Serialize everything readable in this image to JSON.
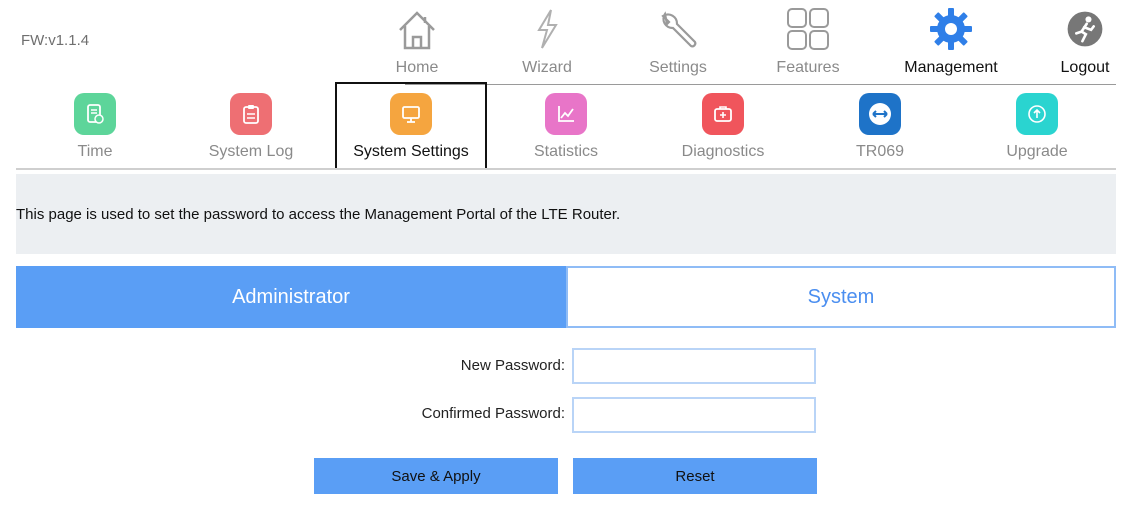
{
  "firmware": "FW:v1.1.4",
  "topnav": [
    {
      "name": "home",
      "label": "Home",
      "icon": "house-icon"
    },
    {
      "name": "wizard",
      "label": "Wizard",
      "icon": "lightning-icon"
    },
    {
      "name": "settings",
      "label": "Settings",
      "icon": "wrench-icon"
    },
    {
      "name": "features",
      "label": "Features",
      "icon": "grid-icon"
    },
    {
      "name": "management",
      "label": "Management",
      "icon": "gear-icon",
      "active": true
    },
    {
      "name": "logout",
      "label": "Logout",
      "icon": "running-person-icon"
    }
  ],
  "subnav": [
    {
      "label": "Time",
      "icon": "clock-document-icon",
      "color": "#5dd59a"
    },
    {
      "label": "System Log",
      "icon": "clipboard-icon",
      "color": "#ee6f73"
    },
    {
      "label": "System Settings",
      "icon": "monitor-icon",
      "color": "#f5a53f",
      "active": true
    },
    {
      "label": "Statistics",
      "icon": "chart-icon",
      "color": "#e875c8"
    },
    {
      "label": "Diagnostics",
      "icon": "medical-kit-icon",
      "color": "#f0555c"
    },
    {
      "label": "TR069",
      "icon": "double-arrow-icon",
      "color": "#1e73c8"
    },
    {
      "label": "Upgrade",
      "icon": "upload-circle-icon",
      "color": "#2ad4d0"
    }
  ],
  "info_text": "This page is used to set the password to access the Management Portal of the LTE Router.",
  "tabs": {
    "admin": "Administrator",
    "system": "System",
    "active": "admin"
  },
  "form": {
    "new_password_label": "New Password:",
    "new_password_value": "",
    "confirmed_password_label": "Confirmed Password:",
    "confirmed_password_value": ""
  },
  "buttons": {
    "save": "Save & Apply",
    "reset": "Reset"
  },
  "colors": {
    "accent": "#5a9ef5",
    "active_icon": "#2f7fe8"
  }
}
